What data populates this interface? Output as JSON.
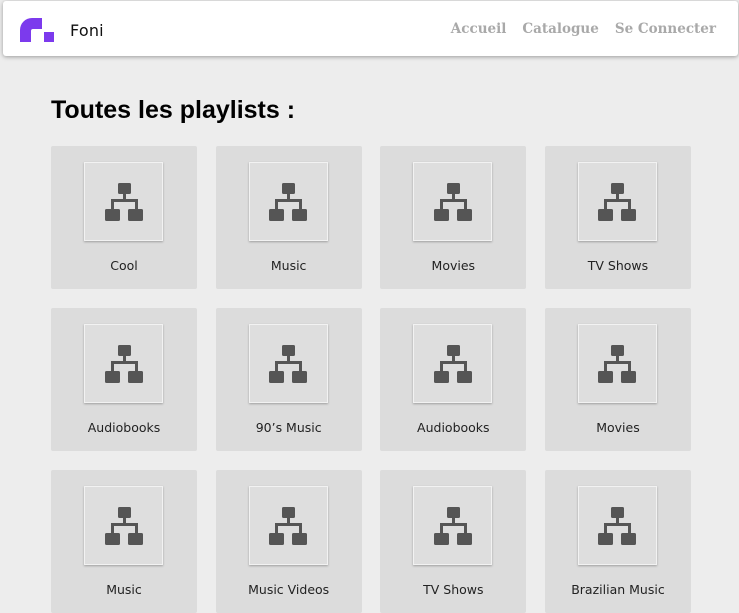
{
  "navbar": {
    "brand": "Foni",
    "brand_color": "#7c3aed",
    "links": [
      "Accueil",
      "Catalogue",
      "Se Connecter"
    ]
  },
  "main": {
    "title": "Toutes les playlists :",
    "playlists": [
      {
        "name": "Cool",
        "icon": "sitemap-icon"
      },
      {
        "name": "Music",
        "icon": "sitemap-icon"
      },
      {
        "name": "Movies",
        "icon": "sitemap-icon"
      },
      {
        "name": "TV Shows",
        "icon": "sitemap-icon"
      },
      {
        "name": "Audiobooks",
        "icon": "sitemap-icon"
      },
      {
        "name": "90’s Music",
        "icon": "sitemap-icon"
      },
      {
        "name": "Audiobooks",
        "icon": "sitemap-icon"
      },
      {
        "name": "Movies",
        "icon": "sitemap-icon"
      },
      {
        "name": "Music",
        "icon": "sitemap-icon"
      },
      {
        "name": "Music Videos",
        "icon": "sitemap-icon"
      },
      {
        "name": "TV Shows",
        "icon": "sitemap-icon"
      },
      {
        "name": "Brazilian Music",
        "icon": "sitemap-icon"
      }
    ]
  }
}
